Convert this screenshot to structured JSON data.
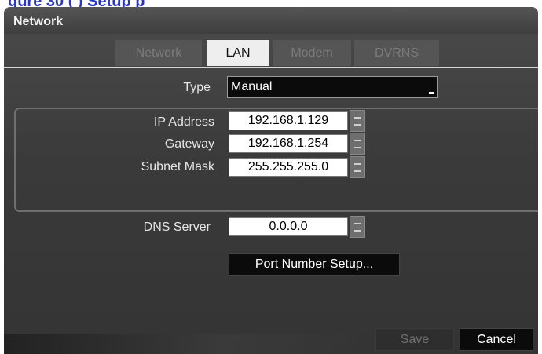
{
  "caption": "gure 30    (                 )  Setup  p",
  "window": {
    "title": "Network"
  },
  "tabs": [
    {
      "label": "Network",
      "active": false
    },
    {
      "label": "LAN",
      "active": true
    },
    {
      "label": "Modem",
      "active": false
    },
    {
      "label": "DVRNS",
      "active": false
    }
  ],
  "type_field": {
    "label": "Type",
    "value": "Manual"
  },
  "ip_group": {
    "ip_address": {
      "label": "IP Address",
      "value": "192.168.1.129"
    },
    "gateway": {
      "label": "Gateway",
      "value": "192.168.1.254"
    },
    "subnet_mask": {
      "label": "Subnet Mask",
      "value": "255.255.255.0"
    }
  },
  "dns_server": {
    "label": "DNS Server",
    "value": "0.0.0.0"
  },
  "port_setup_button": {
    "label": "Port Number Setup..."
  },
  "footer": {
    "save_label": "Save",
    "save_enabled": false,
    "cancel_label": "Cancel"
  }
}
